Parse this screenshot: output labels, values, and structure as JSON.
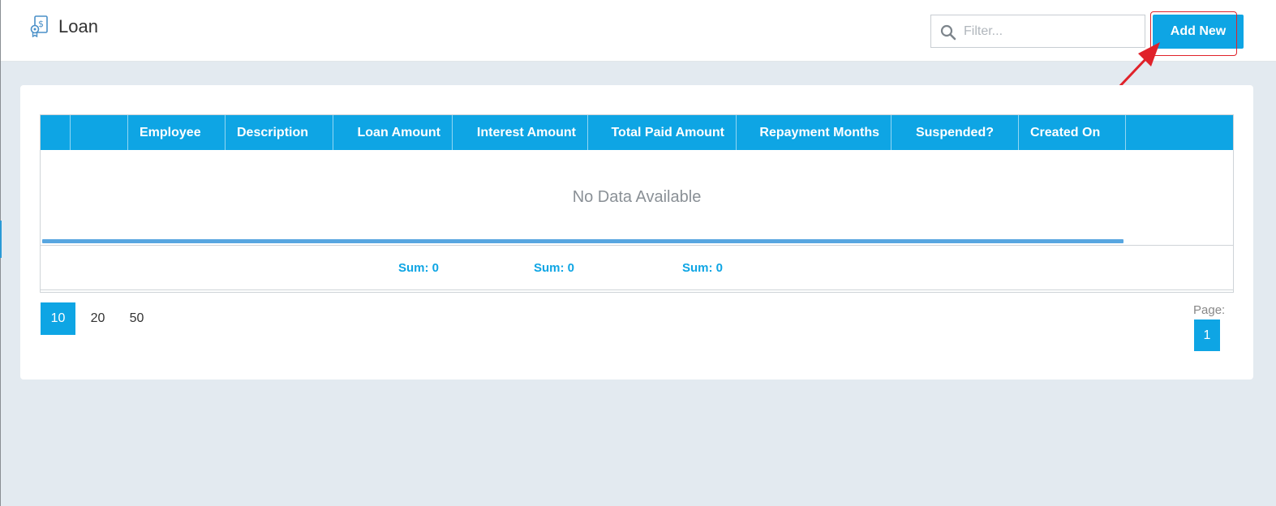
{
  "header": {
    "title": "Loan",
    "filter_placeholder": "Filter...",
    "add_button": "Add New"
  },
  "grid": {
    "columns": [
      "",
      "",
      "Employee",
      "Description",
      "Loan Amount",
      "Interest Amount",
      "Total Paid Amount",
      "Repayment Months",
      "Suspended?",
      "Created On",
      ""
    ],
    "empty_text": "No Data Available",
    "sums": [
      "Sum: 0",
      "Sum: 0",
      "Sum: 0"
    ]
  },
  "pager": {
    "page_sizes": [
      "10",
      "20",
      "50"
    ],
    "active_page_size": "10",
    "page_label": "Page:",
    "current_page": "1"
  },
  "colors": {
    "accent": "#0ea5e4",
    "highlight": "#e0222a"
  },
  "icons": {
    "title": "loan-document-icon",
    "search": "search-icon",
    "annotation": "red-arrow-annotation"
  }
}
